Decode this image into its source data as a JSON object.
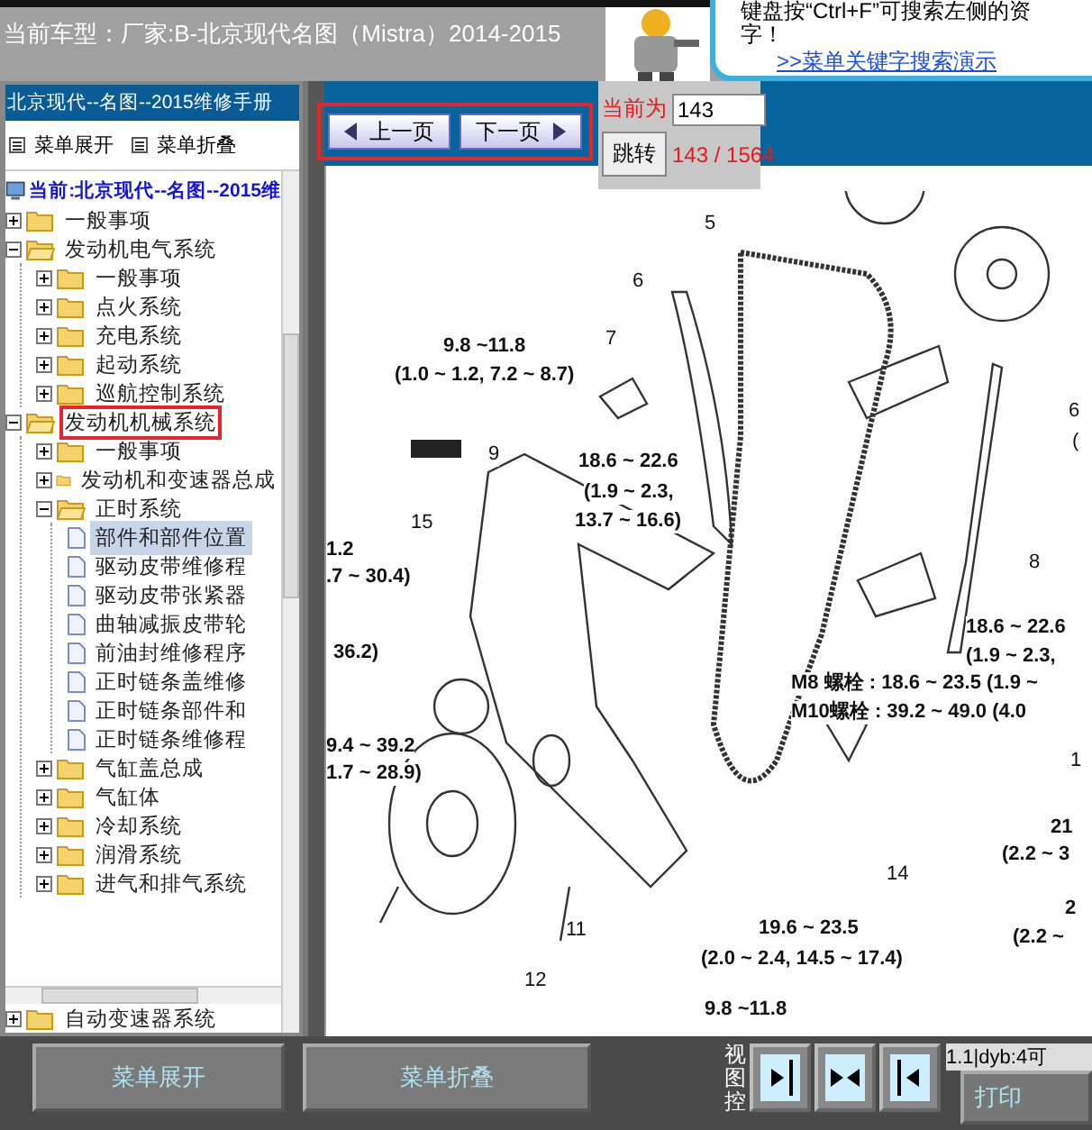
{
  "top_bar": {
    "vehicle": "当前车型：厂家:B-北京现代名图（Mistra）2014-2015",
    "help_lines": [
      "键盘按“Ctrl+F”可搜索左侧的资",
      "字！"
    ],
    "help_link": ">>菜单关键字搜索演示"
  },
  "sidebar": {
    "title": "北京现代--名图--2015维修手册",
    "actions": [
      {
        "label": "菜单展开"
      },
      {
        "label": "菜单折叠"
      }
    ],
    "root": "当前:北京现代--名图--2015维",
    "tree": [
      {
        "kind": "folder",
        "label": "一般事项",
        "expanded": false,
        "selected": false,
        "highlighted": false
      },
      {
        "kind": "folder",
        "label": "发动机电气系统",
        "expanded": true,
        "selected": false,
        "highlighted": false,
        "children": [
          {
            "kind": "folder",
            "label": "一般事项",
            "expanded": false,
            "selected": false,
            "highlighted": false
          },
          {
            "kind": "folder",
            "label": "点火系统",
            "expanded": false,
            "selected": false,
            "highlighted": false
          },
          {
            "kind": "folder",
            "label": "充电系统",
            "expanded": false,
            "selected": false,
            "highlighted": false
          },
          {
            "kind": "folder",
            "label": "起动系统",
            "expanded": false,
            "selected": false,
            "highlighted": false
          },
          {
            "kind": "folder",
            "label": "巡航控制系统",
            "expanded": false,
            "selected": false,
            "highlighted": false
          }
        ]
      },
      {
        "kind": "folder",
        "label": "发动机机械系统",
        "expanded": true,
        "selected": false,
        "highlighted": true,
        "children": [
          {
            "kind": "folder",
            "label": "一般事项",
            "expanded": false,
            "selected": false,
            "highlighted": false
          },
          {
            "kind": "folder",
            "label": "发动机和变速器总成",
            "expanded": false,
            "selected": false,
            "highlighted": false
          },
          {
            "kind": "folder",
            "label": "正时系统",
            "expanded": true,
            "selected": false,
            "highlighted": false,
            "children": [
              {
                "kind": "page",
                "label": "部件和部件位置",
                "selected": true,
                "highlighted": false
              },
              {
                "kind": "page",
                "label": "驱动皮带维修程",
                "selected": false,
                "highlighted": false
              },
              {
                "kind": "page",
                "label": "驱动皮带张紧器",
                "selected": false,
                "highlighted": false
              },
              {
                "kind": "page",
                "label": "曲轴减振皮带轮",
                "selected": false,
                "highlighted": false
              },
              {
                "kind": "page",
                "label": "前油封维修程序",
                "selected": false,
                "highlighted": false
              },
              {
                "kind": "page",
                "label": "正时链条盖维修",
                "selected": false,
                "highlighted": false
              },
              {
                "kind": "page",
                "label": "正时链条部件和",
                "selected": false,
                "highlighted": false
              },
              {
                "kind": "page",
                "label": "正时链条维修程",
                "selected": false,
                "highlighted": false
              }
            ]
          },
          {
            "kind": "folder",
            "label": "气缸盖总成",
            "expanded": false,
            "selected": false,
            "highlighted": false
          },
          {
            "kind": "folder",
            "label": "气缸体",
            "expanded": false,
            "selected": false,
            "highlighted": false
          },
          {
            "kind": "folder",
            "label": "冷却系统",
            "expanded": false,
            "selected": false,
            "highlighted": false
          },
          {
            "kind": "folder",
            "label": "润滑系统",
            "expanded": false,
            "selected": false,
            "highlighted": false
          },
          {
            "kind": "folder",
            "label": "进气和排气系统",
            "expanded": false,
            "selected": false,
            "highlighted": false
          }
        ]
      },
      {
        "kind": "folder",
        "label": "自动变速器系统",
        "expanded": false,
        "selected": false,
        "highlighted": false
      }
    ]
  },
  "pager": {
    "prev": "上一页",
    "next": "下一页",
    "current_label": "当前为",
    "page_value": "143",
    "jump": "跳转",
    "count": "143 / 1564"
  },
  "diagram_labels": [
    {
      "text": "5",
      "bold": false
    },
    {
      "text": "6",
      "bold": false
    },
    {
      "text": "7",
      "bold": false
    },
    {
      "text": "9.8 ~11.8",
      "bold": true
    },
    {
      "text": "(1.0 ~ 1.2, 7.2 ~ 8.7)",
      "bold": true
    },
    {
      "text": "9",
      "bold": false
    },
    {
      "text": "18.6 ~ 22.6",
      "bold": true
    },
    {
      "text": "(1.9 ~ 2.3,",
      "bold": true
    },
    {
      "text": "13.7 ~ 16.6)",
      "bold": true
    },
    {
      "text": "15",
      "bold": false
    },
    {
      "text": "1.2",
      "bold": true
    },
    {
      "text": ".7 ~ 30.4)",
      "bold": true
    },
    {
      "text": "6",
      "bold": false
    },
    {
      "text": "(",
      "bold": false
    },
    {
      "text": "8",
      "bold": false
    },
    {
      "text": "18.6 ~ 22.6",
      "bold": true
    },
    {
      "text": "(1.9 ~ 2.3,",
      "bold": true
    },
    {
      "text": "36.2)",
      "bold": true
    },
    {
      "text": "M8 螺栓 : 18.6 ~ 23.5 (1.9 ~",
      "bold": true
    },
    {
      "text": "M10螺栓 : 39.2 ~ 49.0 (4.0",
      "bold": true
    },
    {
      "text": "9.4 ~ 39.2",
      "bold": true
    },
    {
      "text": "1.7 ~ 28.9)",
      "bold": true
    },
    {
      "text": "1",
      "bold": false
    },
    {
      "text": "21",
      "bold": true
    },
    {
      "text": "(2.2 ~ 3",
      "bold": true
    },
    {
      "text": "14",
      "bold": false
    },
    {
      "text": "11",
      "bold": false
    },
    {
      "text": "2",
      "bold": true
    },
    {
      "text": "(2.2 ~",
      "bold": true
    },
    {
      "text": "19.6 ~ 23.5",
      "bold": true
    },
    {
      "text": "(2.0 ~ 2.4, 14.5 ~ 17.4)",
      "bold": true
    },
    {
      "text": "12",
      "bold": false
    },
    {
      "text": "9.8 ~11.8",
      "bold": true
    }
  ],
  "bottom_bar": {
    "expand": "菜单展开",
    "collapse": "菜单折叠",
    "view_label": "视图控",
    "status": "1.1|dyb:4可",
    "print": "打印"
  }
}
